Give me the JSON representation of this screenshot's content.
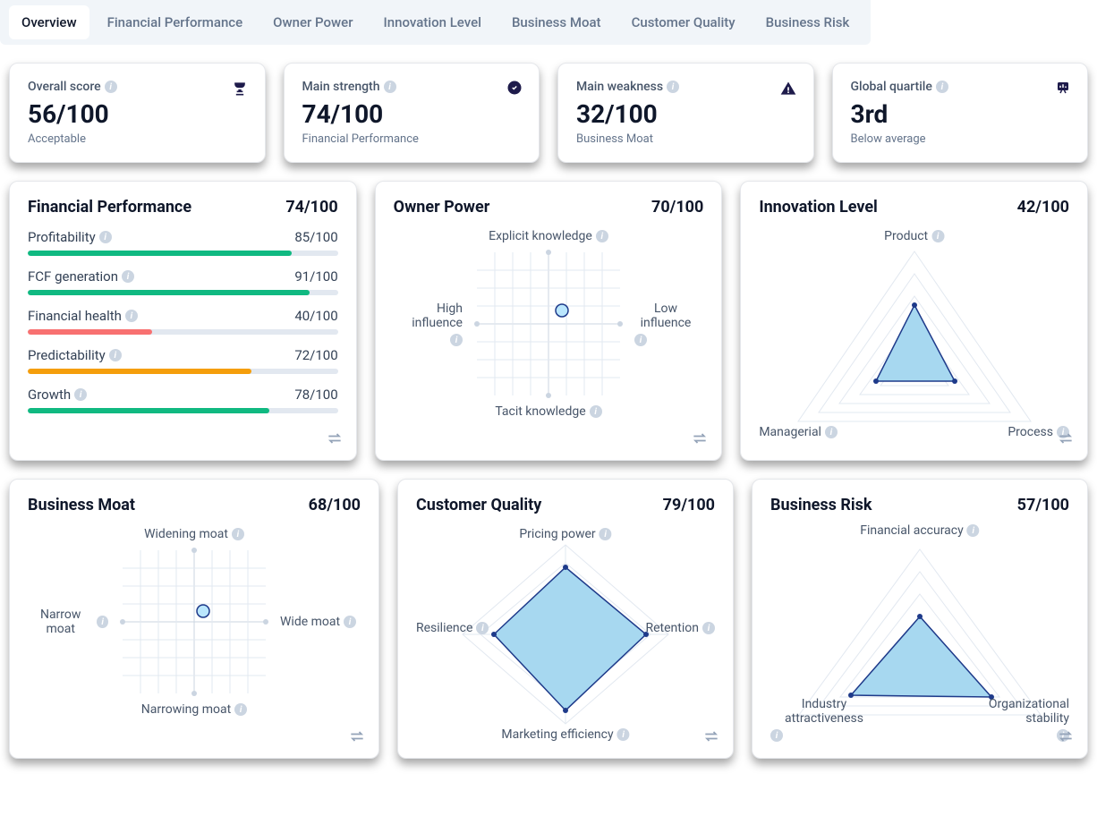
{
  "tabs": [
    "Overview",
    "Financial Performance",
    "Owner Power",
    "Innovation Level",
    "Business Moat",
    "Customer Quality",
    "Business Risk"
  ],
  "summary": {
    "overall": {
      "title": "Overall score",
      "value": "56/100",
      "sub": "Acceptable"
    },
    "strength": {
      "title": "Main strength",
      "value": "74/100",
      "sub": "Financial Performance"
    },
    "weakness": {
      "title": "Main weakness",
      "value": "32/100",
      "sub": "Business Moat"
    },
    "quartile": {
      "title": "Global quartile",
      "value": "3rd",
      "sub": "Below average"
    }
  },
  "panels": {
    "financial": {
      "title": "Financial Performance",
      "score": "74/100",
      "metrics": [
        {
          "label": "Profitability",
          "value": "85/100",
          "pct": 85,
          "color": "#10b981"
        },
        {
          "label": "FCF generation",
          "value": "91/100",
          "pct": 91,
          "color": "#10b981"
        },
        {
          "label": "Financial health",
          "value": "40/100",
          "pct": 40,
          "color": "#f87171"
        },
        {
          "label": "Predictability",
          "value": "72/100",
          "pct": 72,
          "color": "#f59e0b"
        },
        {
          "label": "Growth",
          "value": "78/100",
          "pct": 78,
          "color": "#10b981"
        }
      ]
    },
    "owner": {
      "title": "Owner Power",
      "score": "70/100",
      "top": "Explicit knowledge",
      "bottom": "Tacit knowledge",
      "left": "High influence",
      "right": "Low influence"
    },
    "innovation": {
      "title": "Innovation Level",
      "score": "42/100",
      "axes": [
        "Product",
        "Process",
        "Managerial"
      ]
    },
    "moat": {
      "title": "Business Moat",
      "score": "68/100",
      "top": "Widening moat",
      "bottom": "Narrowing moat",
      "left": "Narrow moat",
      "right": "Wide moat"
    },
    "customer": {
      "title": "Customer Quality",
      "score": "79/100",
      "axes": [
        "Pricing power",
        "Retention",
        "Marketing efficiency",
        "Resilience"
      ]
    },
    "risk": {
      "title": "Business Risk",
      "score": "57/100",
      "axes": [
        "Financial accuracy",
        "Organizational stability",
        "Industry attractiveness"
      ]
    }
  },
  "chart_data": [
    {
      "type": "bar",
      "title": "Financial Performance 74/100",
      "categories": [
        "Profitability",
        "FCF generation",
        "Financial health",
        "Predictability",
        "Growth"
      ],
      "values": [
        85,
        91,
        40,
        72,
        78
      ],
      "ylim": [
        0,
        100
      ]
    },
    {
      "type": "scatter",
      "title": "Owner Power 70/100",
      "xlabel": "High influence ↔ Low influence",
      "ylabel": "Explicit knowledge ↔ Tacit knowledge",
      "x": [
        0.6
      ],
      "y": [
        0.65
      ],
      "xlim": [
        0,
        1
      ],
      "ylim": [
        0,
        1
      ]
    },
    {
      "type": "scatter",
      "title": "Business Moat 68/100",
      "xlabel": "Narrow moat ↔ Wide moat",
      "ylabel": "Widening moat ↔ Narrowing moat",
      "x": [
        0.55
      ],
      "y": [
        0.55
      ],
      "xlim": [
        0,
        1
      ],
      "ylim": [
        0,
        1
      ]
    },
    {
      "type": "area",
      "title": "Innovation Level 42/100 (radar)",
      "categories": [
        "Product",
        "Process",
        "Managerial"
      ],
      "values": [
        55,
        35,
        35
      ],
      "ylim": [
        0,
        100
      ]
    },
    {
      "type": "area",
      "title": "Customer Quality 79/100 (radar)",
      "categories": [
        "Pricing power",
        "Retention",
        "Marketing efficiency",
        "Resilience"
      ],
      "values": [
        75,
        80,
        85,
        70
      ],
      "ylim": [
        0,
        100
      ]
    },
    {
      "type": "area",
      "title": "Business Risk 57/100 (radar)",
      "categories": [
        "Financial accuracy",
        "Organizational stability",
        "Industry attractiveness"
      ],
      "values": [
        45,
        60,
        55
      ],
      "ylim": [
        0,
        100
      ]
    }
  ]
}
